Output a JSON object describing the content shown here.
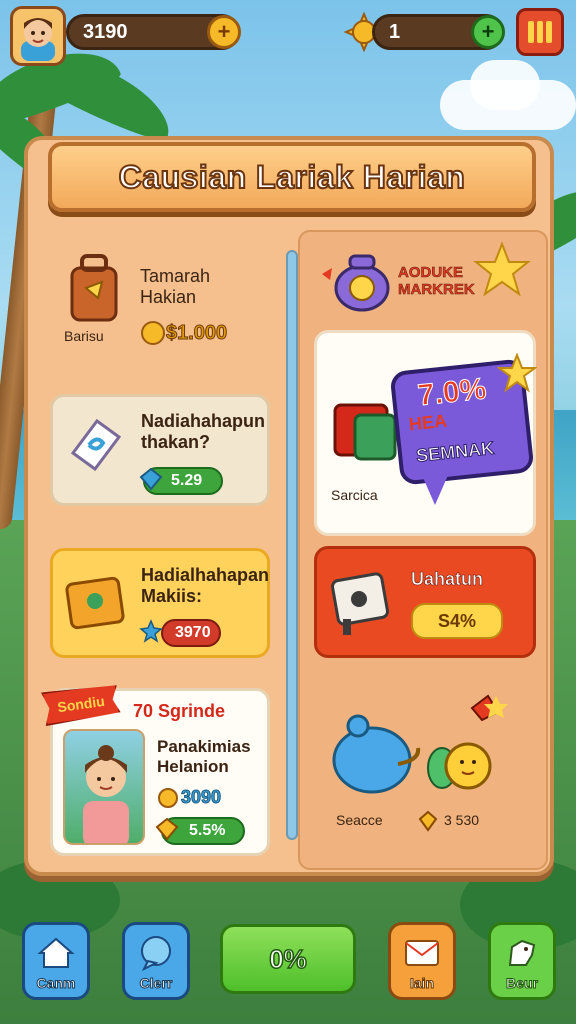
{
  "topbar": {
    "coins": "3190",
    "gems": "1",
    "coins_plus": "+",
    "gems_plus": "+"
  },
  "panel": {
    "title": "Causian Lariak Harian"
  },
  "left_cards": [
    {
      "title": "Tamarah Hakian",
      "badge": "Barisu",
      "price": "$1.000"
    },
    {
      "title": "Nadiahahapun thakan?",
      "price": "5.29"
    },
    {
      "title": "Hadialhahapan Makiis:",
      "price": "3970"
    },
    {
      "ribbon": "Sondiu",
      "heading": "70 Sgrinde",
      "title": "Panakimias Helanion",
      "coins": "3090",
      "price": "5.5%"
    }
  ],
  "right_cards": {
    "header": "AODUKE MARKREK",
    "speech_line1": "7.0%",
    "speech_line2": "HEA",
    "speech_line3": "SEMNAK",
    "gift_label": "Sarcica",
    "red_card_title": "Uahatun",
    "red_card_price": "S4%",
    "bottom_label": "Seacce",
    "bottom_price": "3 530"
  },
  "bottom_nav": {
    "btn1": "Canm",
    "btn2": "Clerr",
    "center": "0%",
    "btn4": "Iain",
    "btn5": "Beur"
  },
  "colors": {
    "panel": "#f5c08e",
    "accent_green": "#3da53b",
    "accent_red": "#ea4a22",
    "accent_yellow": "#ffd25c"
  }
}
